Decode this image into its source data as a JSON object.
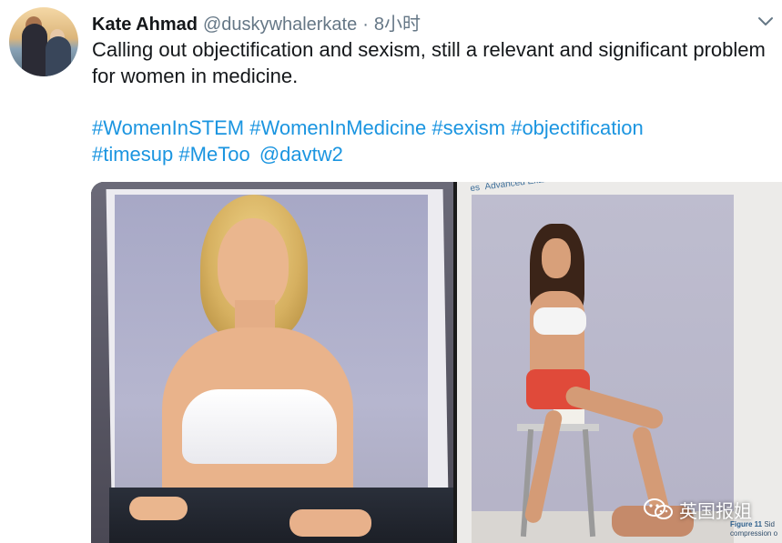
{
  "tweet": {
    "author_name": "Kate Ahmad",
    "handle": "@duskywhalerkate",
    "separator": "·",
    "time": "8小时",
    "text": "Calling out objectification and sexism, still a relevant and significant problem for women in medicine.",
    "hashtags": [
      "#WomenInSTEM",
      "#WomenInMedicine",
      "#sexism",
      "#objectification",
      "#timesup",
      "#MeToo"
    ],
    "mention": "@davtw2"
  },
  "icons": {
    "avatar": "profile-photo",
    "caret": "chevron-down-icon",
    "emoji": "raised-hand-emoji",
    "watermark_logo": "wechat-icon"
  },
  "media": {
    "right_page_header": "Advanced Examination Tec",
    "right_page_tab": "es",
    "figure_label": "Figure 11",
    "figure_caption_fragment": "Sid",
    "figure_caption_line2": "compression o"
  },
  "watermark": {
    "text": "英国报姐"
  },
  "colors": {
    "link": "#1b95e0",
    "secondary_text": "#657786",
    "primary_text": "#14171a"
  }
}
